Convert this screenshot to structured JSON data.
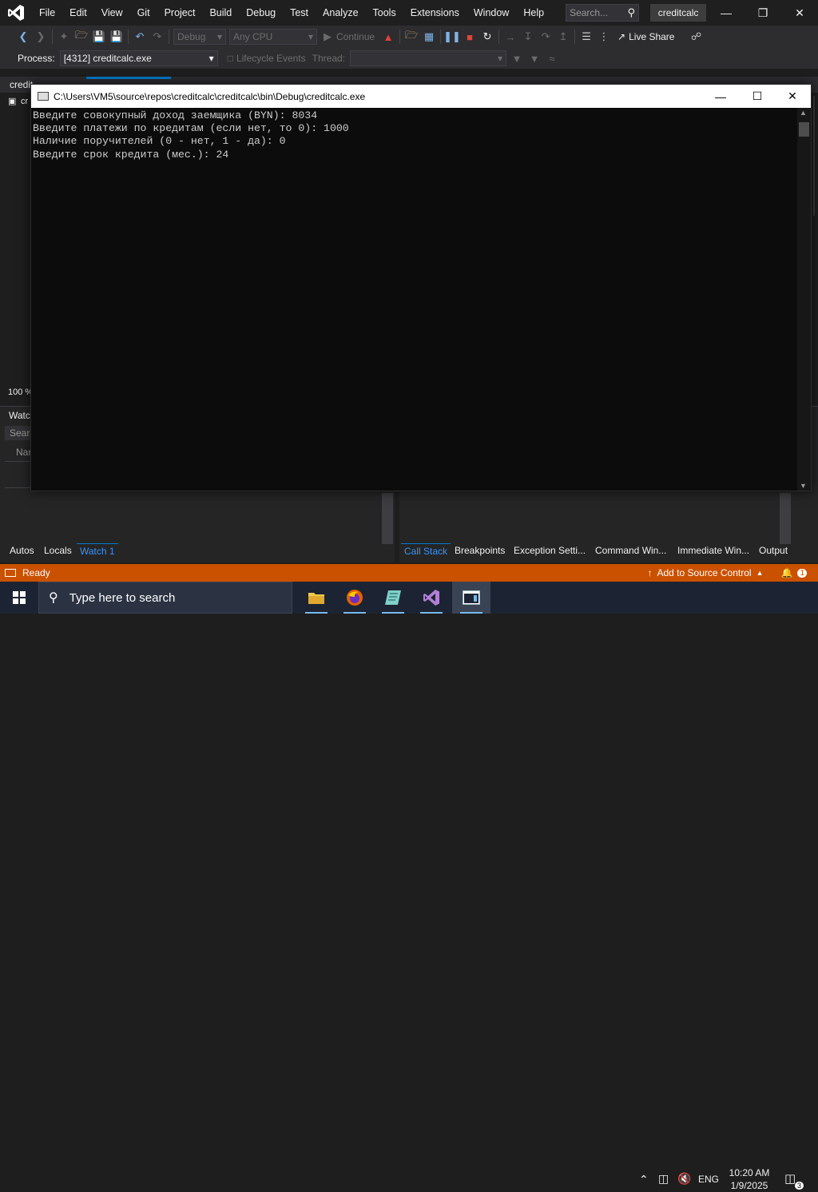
{
  "menu": {
    "items": [
      "File",
      "Edit",
      "View",
      "Git",
      "Project",
      "Build",
      "Debug",
      "Test",
      "Analyze",
      "Tools",
      "Extensions",
      "Window",
      "Help"
    ],
    "search_placeholder": "Search...",
    "solution_name": "creditcalc"
  },
  "toolbar": {
    "config": "Debug",
    "platform": "Any CPU",
    "continue_label": "Continue",
    "live_share_label": "Live Share"
  },
  "process_bar": {
    "label": "Process:",
    "value": "[4312] creditcalc.exe",
    "lifecycle_label": "Lifecycle Events",
    "thread_label": "Thread:"
  },
  "ide": {
    "doc_tab_partial": "credit",
    "cs_tab_partial": "cr",
    "zoom": "100 %",
    "watch_header_partial": "Watc",
    "watch_search_partial": "Searc",
    "watch_name_partial": "Nar"
  },
  "bottom_tabs_left": [
    "Autos",
    "Locals",
    "Watch 1"
  ],
  "bottom_tabs_right": [
    "Call Stack",
    "Breakpoints",
    "Exception Setti...",
    "Command Win...",
    "Immediate Win...",
    "Output"
  ],
  "status": {
    "text": "Ready",
    "source_control": "Add to Source Control",
    "notifications": "1"
  },
  "console": {
    "title": "C:\\Users\\VM5\\source\\repos\\creditcalc\\creditcalc\\bin\\Debug\\creditcalc.exe",
    "lines": [
      "Введите совокупный доход заемщика (BYN): 8034",
      "Введите платежи по кредитам (если нет, то 0): 1000",
      "Наличие поручителей (0 - нет, 1 - да): 0",
      "Введите срок кредита (мес.): 24"
    ]
  },
  "taskbar": {
    "search_placeholder": "Type here to search",
    "language": "ENG",
    "time": "10:20 AM",
    "date": "1/9/2025",
    "notification_count": "3"
  },
  "colors": {
    "status_bar": "#ca5100",
    "accent_blue": "#3794ff",
    "console_bg": "#0c0c0c"
  }
}
